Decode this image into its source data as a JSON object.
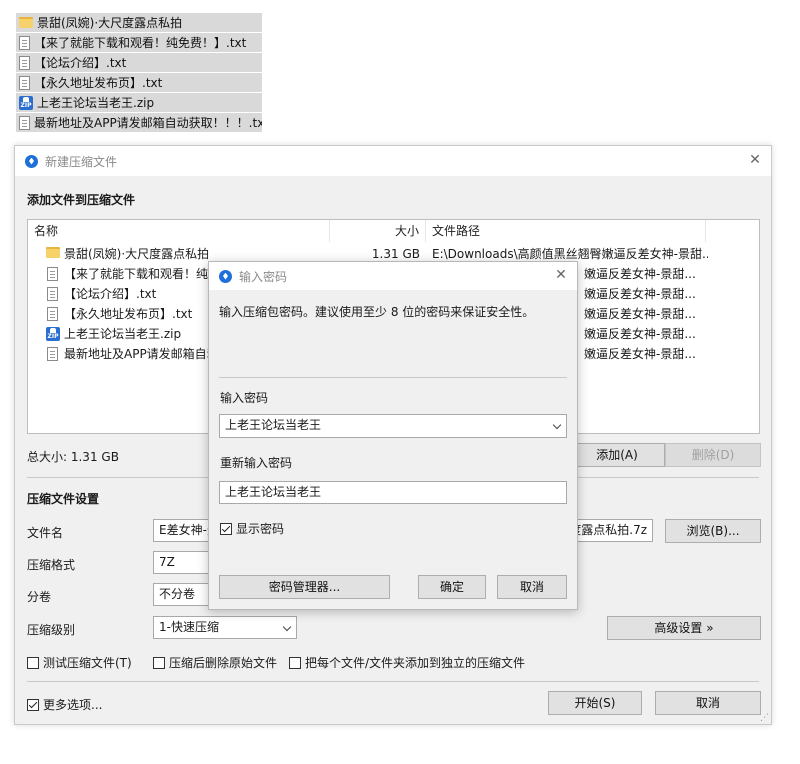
{
  "desktop_files": [
    {
      "icon": "folder",
      "name": "景甜(凤婉)·大尺度露点私拍"
    },
    {
      "icon": "txt",
      "name": "【来了就能下载和观看！纯免费！】.txt"
    },
    {
      "icon": "txt",
      "name": "【论坛介绍】.txt"
    },
    {
      "icon": "txt",
      "name": "【永久地址发布页】.txt"
    },
    {
      "icon": "zip",
      "name": "上老王论坛当老王.zip"
    },
    {
      "icon": "txt",
      "name": "最新地址及APP请发邮箱自动获取！！！.txt"
    }
  ],
  "window": {
    "title": "新建压缩文件",
    "add_files_heading": "添加文件到压缩文件",
    "columns": {
      "name": "名称",
      "size": "大小",
      "path": "文件路径"
    },
    "rows": [
      {
        "icon": "folder",
        "name": "景甜(凤婉)·大尺度露点私拍",
        "size": "1.31 GB",
        "path": "E:\\Downloads\\高颜值黑丝翘臀嫩逼反差女神-景甜..."
      },
      {
        "icon": "txt",
        "name": "【来了就能下载和观看！纯免费",
        "size": "",
        "path": "嫩逼反差女神-景甜..."
      },
      {
        "icon": "txt",
        "name": "【论坛介绍】.txt",
        "size": "",
        "path": "嫩逼反差女神-景甜..."
      },
      {
        "icon": "txt",
        "name": "【永久地址发布页】.txt",
        "size": "",
        "path": "嫩逼反差女神-景甜..."
      },
      {
        "icon": "zip",
        "name": "上老王论坛当老王.zip",
        "size": "",
        "path": "嫩逼反差女神-景甜..."
      },
      {
        "icon": "txt",
        "name": "最新地址及APP请发邮箱自动获",
        "size": "",
        "path": "嫩逼反差女神-景甜..."
      }
    ],
    "total_size": "总大小: 1.31 GB",
    "add_button": "添加(A)",
    "delete_button": "删除(D)",
    "settings_heading": "压缩文件设置",
    "filename_label": "文件名",
    "filename_value_left": "E差女神-景",
    "filename_value_right": "度露点私拍.7z",
    "browse_button": "浏览(B)...",
    "format_label": "压缩格式",
    "format_value": "7Z",
    "split_label": "分卷",
    "split_value": "不分卷",
    "level_label": "压缩级别",
    "level_value": "1-快速压缩",
    "advanced_button": "高级设置 »",
    "test_checkbox": "测试压缩文件(T)",
    "delete_original_checkbox": "压缩后删除原始文件",
    "separate_checkbox": "把每个文件/文件夹添加到独立的压缩文件",
    "more_options": "更多选项...",
    "start_button": "开始(S)",
    "cancel_button": "取消"
  },
  "password_dialog": {
    "title": "输入密码",
    "description": "输入压缩包密码。建议使用至少 8 位的密码来保证安全性。",
    "password_label": "输入密码",
    "password_value": "上老王论坛当老王",
    "reenter_label": "重新输入密码",
    "reenter_value": "上老王论坛当老王",
    "show_password": "显示密码",
    "manager_button": "密码管理器...",
    "ok_button": "确定",
    "cancel_button": "取消"
  },
  "colors": {
    "accent": "#1e6fd9",
    "folder": "#f7d26b",
    "window_bg": "#f0f0f0"
  }
}
